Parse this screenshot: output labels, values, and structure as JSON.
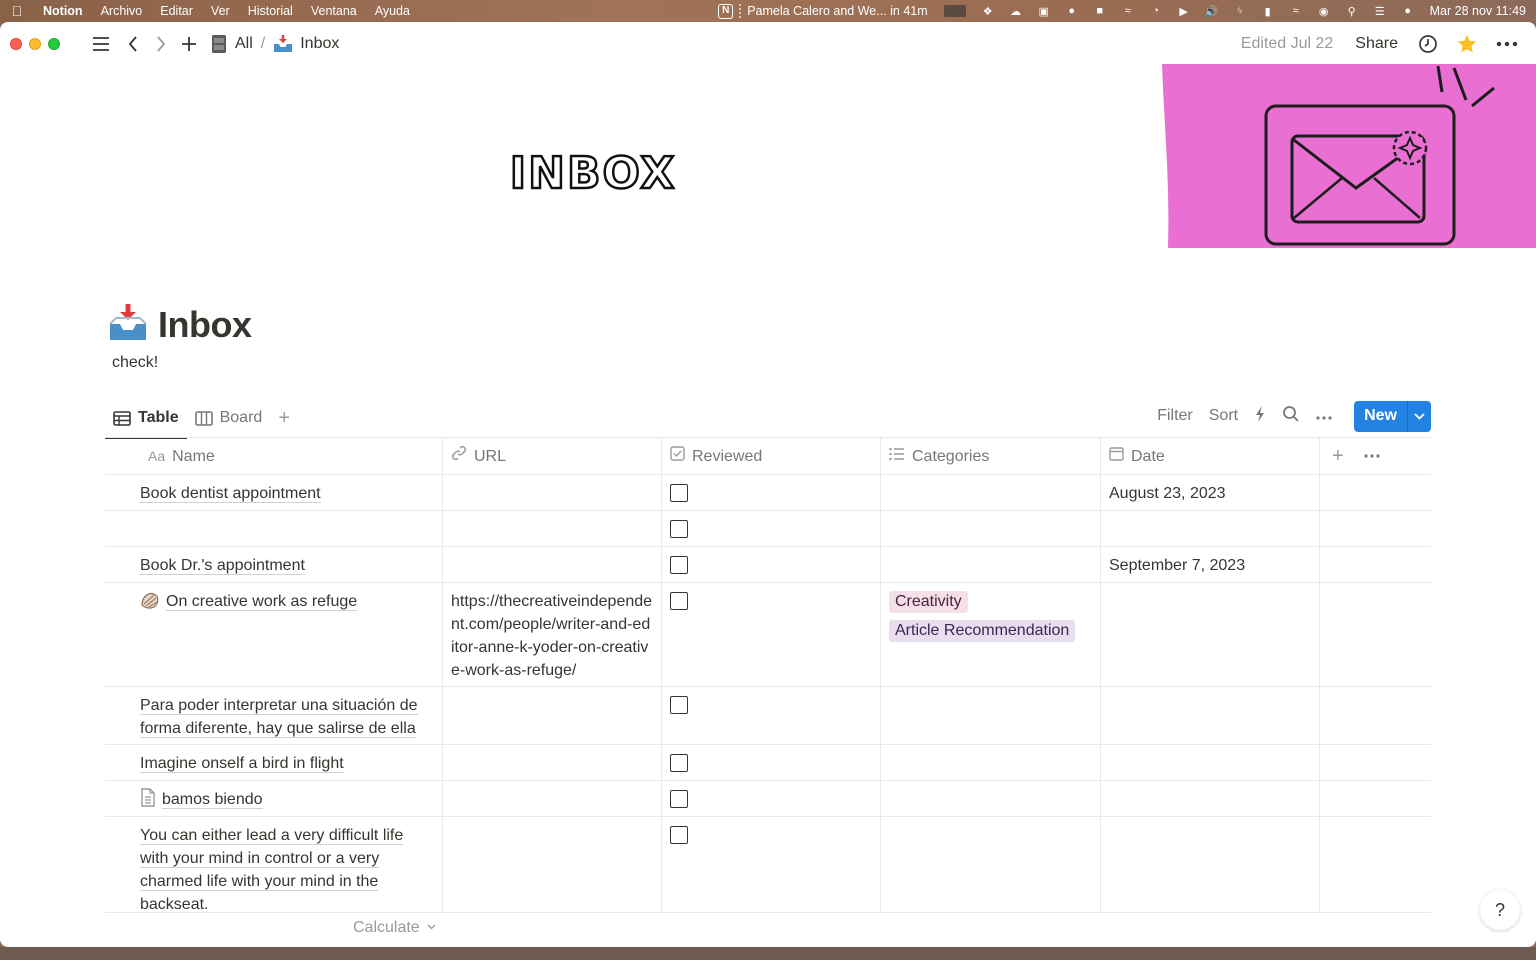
{
  "menubar": {
    "items": [
      "Notion",
      "Archivo",
      "Editar",
      "Ver",
      "Historial",
      "Ventana",
      "Ayuda"
    ],
    "event": "Pamela Calero and We... in 41m",
    "clock": "Mar 28 nov  11:49",
    "notion_badge": "N"
  },
  "toolbar": {
    "breadcrumb_all": "All",
    "breadcrumb_sep": "/",
    "breadcrumb_page": "Inbox",
    "edited": "Edited Jul 22",
    "share": "Share"
  },
  "cover": {
    "title_art": "INBOX"
  },
  "page": {
    "title": "Inbox",
    "description": "check!"
  },
  "views": {
    "tabs": [
      "Table",
      "Board"
    ],
    "tools": {
      "filter": "Filter",
      "sort": "Sort",
      "new": "New"
    }
  },
  "table": {
    "headers": {
      "prefix": "Aa",
      "name": "Name",
      "url": "URL",
      "reviewed": "Reviewed",
      "categories": "Categories",
      "date": "Date"
    },
    "rows": [
      {
        "name": "Book dentist appointment",
        "url": "",
        "reviewed": false,
        "categories": [],
        "date": "August 23, 2023"
      },
      {
        "name": "",
        "url": "",
        "reviewed": false,
        "categories": [],
        "date": ""
      },
      {
        "name": "Book Dr.'s appointment",
        "url": "",
        "reviewed": false,
        "categories": [],
        "date": "September 7, 2023"
      },
      {
        "name": "On creative work as refuge",
        "url": "https://thecreativeindependent.com/people/writer-and-editor-anne-k-yoder-on-creative-work-as-refuge/",
        "reviewed": false,
        "categories": [
          "Creativity",
          "Article Recommendation"
        ],
        "date": ""
      },
      {
        "name": "Para poder interpretar una situación de forma diferente, hay que salirse de ella",
        "url": "",
        "reviewed": false,
        "categories": [],
        "date": ""
      },
      {
        "name": "Imagine onself a bird in flight",
        "url": "",
        "reviewed": false,
        "categories": [],
        "date": ""
      },
      {
        "name": "bamos biendo",
        "url": "",
        "reviewed": false,
        "categories": [],
        "date": ""
      },
      {
        "name": "You can either lead a very difficult life with your mind in control or a very charmed life with your mind in the backseat.",
        "url": "",
        "reviewed": false,
        "categories": [],
        "date": ""
      }
    ],
    "calculate": "Calculate"
  },
  "help": "?",
  "colors": {
    "accent": "#2383e2",
    "cover_pink": "#e96fd2",
    "tag_pink": "#f5e0e9",
    "tag_purple": "#e8deee"
  }
}
